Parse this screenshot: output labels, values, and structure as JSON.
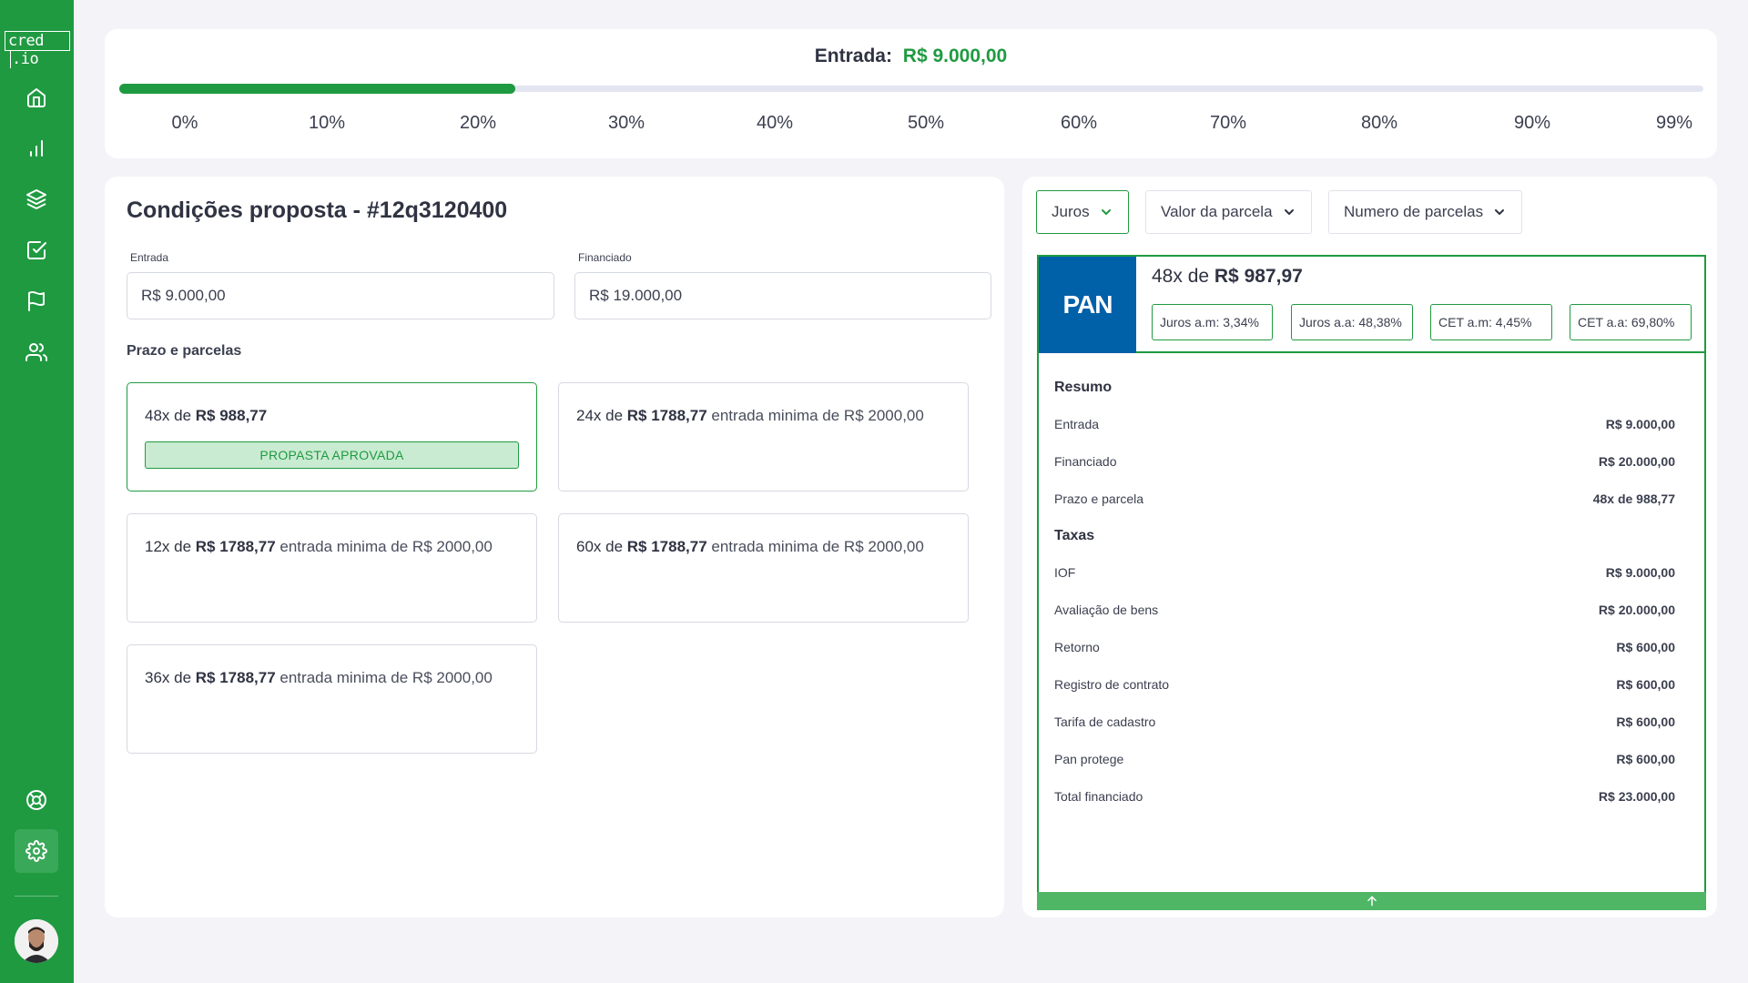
{
  "brand": {
    "logo": "cred",
    "logo_suffix": ".io",
    "accent": "#1f9a41"
  },
  "sidebar": {
    "items": [
      {
        "icon": "home-icon"
      },
      {
        "icon": "bar-chart-icon"
      },
      {
        "icon": "layers-icon"
      },
      {
        "icon": "check-square-icon"
      },
      {
        "icon": "flag-icon"
      },
      {
        "icon": "users-icon"
      }
    ],
    "bottom": [
      {
        "icon": "lifebuoy-icon"
      },
      {
        "icon": "gear-icon"
      }
    ]
  },
  "slider": {
    "label": "Entrada:",
    "value": "R$ 9.000,00",
    "fill_fraction": 0.25,
    "ticks": [
      "0%",
      "10%",
      "20%",
      "30%",
      "40%",
      "50%",
      "60%",
      "70%",
      "80%",
      "90%",
      "99%"
    ]
  },
  "proposal": {
    "title": "Condições proposta - #12q3120400",
    "entrada_label": "Entrada",
    "entrada_value": "R$ 9.000,00",
    "financiado_label": "Financiado",
    "financiado_value": "R$ 19.000,00",
    "section_label": "Prazo e parcelas",
    "options": [
      {
        "prefix": "48x de ",
        "amount": "R$ 988,77",
        "suffix": "",
        "badge": "PROPASTA APROVADA"
      },
      {
        "prefix": "24x de ",
        "amount": "R$ 1788,77",
        "suffix": " entrada minima de R$ 2000,00"
      },
      {
        "prefix": "12x de ",
        "amount": "R$ 1788,77",
        "suffix": " entrada minima de R$ 2000,00"
      },
      {
        "prefix": "60x de ",
        "amount": "R$ 1788,77",
        "suffix": " entrada minima de R$ 2000,00"
      },
      {
        "prefix": "36x de ",
        "amount": "R$ 1788,77",
        "suffix": " entrada minima de R$ 2000,00"
      }
    ]
  },
  "filters": [
    {
      "label": "Juros"
    },
    {
      "label": "Valor da parcela"
    },
    {
      "label": "Numero de parcelas"
    }
  ],
  "offer": {
    "bank": "PAN",
    "title_prefix": "48x de ",
    "title_amount": "R$ 987,97",
    "chips": [
      "Juros a.m:  3,34%",
      "Juros a.a: 48,38%",
      "CET a.m: 4,45%",
      "CET a.a: 69,80%"
    ],
    "resumo_title": "Resumo",
    "resumo": [
      {
        "label": "Entrada",
        "value": "R$ 9.000,00"
      },
      {
        "label": "Financiado",
        "value": "R$ 20.000,00"
      },
      {
        "label": "Prazo e parcela",
        "value": "48x de 988,77"
      }
    ],
    "taxas_title": "Taxas",
    "taxas": [
      {
        "label": "IOF",
        "value": "R$ 9.000,00"
      },
      {
        "label": "Avaliação de bens",
        "value": "R$ 20.000,00"
      },
      {
        "label": "Retorno",
        "value": "R$ 600,00"
      },
      {
        "label": "Registro de contrato",
        "value": "R$ 600,00"
      },
      {
        "label": "Tarifa de cadastro",
        "value": "R$ 600,00"
      },
      {
        "label": "Pan protege",
        "value": "R$ 600,00"
      },
      {
        "label": "Total financiado",
        "value": "R$ 23.000,00"
      }
    ]
  }
}
